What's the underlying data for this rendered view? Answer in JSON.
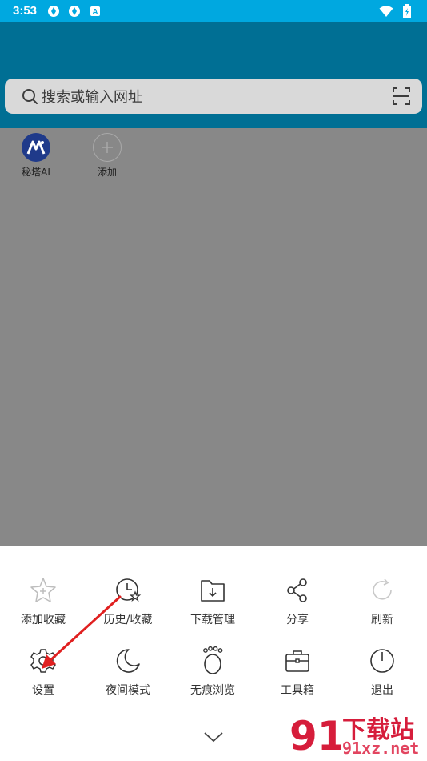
{
  "status_bar": {
    "time": "3:53",
    "left_icons": [
      "gear-badge-icon",
      "gear-badge-icon",
      "android-a-icon"
    ],
    "right_icons": [
      "wifi-icon",
      "battery-icon"
    ],
    "color": "#00a8e0"
  },
  "header": {
    "color": "#006f94"
  },
  "search": {
    "placeholder": "搜索或输入网址"
  },
  "shortcuts": [
    {
      "label": "秘塔AI",
      "icon": "metaso-logo-icon"
    },
    {
      "label": "添加",
      "icon": "add-circle-icon"
    }
  ],
  "menu": {
    "items": [
      {
        "label": "添加收藏",
        "icon": "star-plus-icon",
        "enabled": false
      },
      {
        "label": "历史/收藏",
        "icon": "clock-star-icon",
        "enabled": true
      },
      {
        "label": "下载管理",
        "icon": "folder-download-icon",
        "enabled": true
      },
      {
        "label": "分享",
        "icon": "share-icon",
        "enabled": true
      },
      {
        "label": "刷新",
        "icon": "refresh-icon",
        "enabled": false
      },
      {
        "label": "设置",
        "icon": "gear-icon",
        "enabled": true
      },
      {
        "label": "夜间模式",
        "icon": "moon-icon",
        "enabled": true
      },
      {
        "label": "无痕浏览",
        "icon": "footprint-icon",
        "enabled": true
      },
      {
        "label": "工具箱",
        "icon": "toolbox-icon",
        "enabled": true
      },
      {
        "label": "退出",
        "icon": "power-icon",
        "enabled": true
      }
    ]
  },
  "collapse_icon": "chevron-down-icon",
  "annotation": {
    "color": "#e02020",
    "target": "设置"
  },
  "watermark": {
    "text_cn": "下载站",
    "text_domain": "91xz.net",
    "logo_text": "91",
    "color": "#d61d3b"
  }
}
